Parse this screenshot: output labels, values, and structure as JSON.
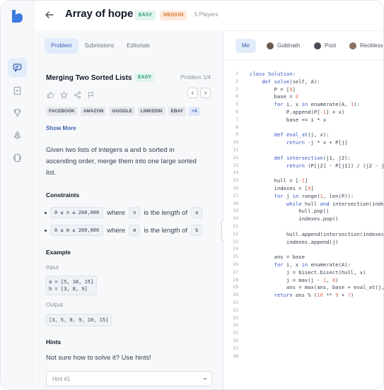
{
  "header": {
    "title": "Array of hope",
    "difficulty_easy": "EASY",
    "difficulty_medium": "MEDIUM",
    "players": "5 Players"
  },
  "sidebar": {
    "items": [
      {
        "icon": "chat-icon",
        "active": true
      },
      {
        "icon": "document-icon",
        "active": false
      },
      {
        "icon": "trophy-icon",
        "active": false
      },
      {
        "icon": "rocket-icon",
        "active": false
      },
      {
        "icon": "layers-icon",
        "active": false
      }
    ]
  },
  "left_tabs": [
    "Problem",
    "Submisions",
    "Editorials"
  ],
  "problem": {
    "title": "Merging Two Sorted Lists",
    "difficulty": "EASY",
    "number": "Problem 1/4",
    "tags": [
      "FACEBOOK",
      "AMAZON",
      "GOOGLE",
      "LINKEDIN",
      "EBAY",
      "+4"
    ],
    "show_more": "Show More",
    "description": "Given two lists of integers a and b sorted in ascending order, merge them into one large sorted list.",
    "constraints_title": "Constraints",
    "constraints": [
      {
        "code": "0 ≤ n ≤ 200,000",
        "where": "where",
        "var": "n",
        "text": "is the length of",
        "target": "a"
      },
      {
        "code": "0 ≤ m ≤ 200,000",
        "where": "where",
        "var": "m",
        "text": "is the length of",
        "target": "b"
      }
    ],
    "example_title": "Example",
    "input_label": "Input",
    "input_value": "a = [5, 10, 15]\nb = [3, 8, 9]",
    "output_label": "Output",
    "output_value": "[3, 5, 8, 9, 10, 15]",
    "hints_title": "Hints",
    "hints_text": "Not sure how to solve it? Use hints!",
    "hint_select": "Hint #1"
  },
  "player_tabs": [
    {
      "label": "Me",
      "active": true
    },
    {
      "label": "Gobinath",
      "active": false
    },
    {
      "label": "Pool",
      "active": false
    },
    {
      "label": "Reckless",
      "active": false
    }
  ],
  "code_lines": [
    {
      "n": "1",
      "html": "<span class='kw'>class</span> <span class='fn'>Solution</span>:"
    },
    {
      "n": "2",
      "html": "    <span class='kw'>def</span> <span class='fn'>solve</span>(self, A):"
    },
    {
      "n": "3",
      "html": "        P = [<span class='num'>0</span>]"
    },
    {
      "n": "4",
      "html": "        base = <span class='num'>0</span>"
    },
    {
      "n": "5",
      "html": "        <span class='kw'>for</span> i, x <span class='kw'>in</span> enumerate(A, <span class='num'>1</span>):"
    },
    {
      "n": "6",
      "html": "            P.append(P[<span class='num'>-1</span>] + x)"
    },
    {
      "n": "7",
      "html": "            base += i * x"
    },
    {
      "n": "8",
      "html": ""
    },
    {
      "n": "9",
      "html": "        <span class='kw'>def</span> <span class='fn'>eval_at</span>(j, x):"
    },
    {
      "n": "10",
      "html": "            <span class='kw'>return</span> -j * x + P[j]"
    },
    {
      "n": "11",
      "html": ""
    },
    {
      "n": "12",
      "html": "        <span class='kw'>def</span> <span class='fn'>intersection</span>(j1, j2):"
    },
    {
      "n": "13",
      "html": "            <span class='kw'>return</span> (P[j2] - P[j1]) / (j2 - j1)"
    },
    {
      "n": "14",
      "html": ""
    },
    {
      "n": "15",
      "html": "        hull = [<span class='num'>-1</span>]"
    },
    {
      "n": "16",
      "html": "        indexes = [<span class='num'>0</span>]"
    },
    {
      "n": "17",
      "html": "        <span class='kw'>for</span> j <span class='kw'>in</span> range(<span class='num'>1</span>, len(P)):"
    },
    {
      "n": "18",
      "html": "            <span class='kw'>while</span> hull <span class='kw'>and</span> intersection(indexes[-1], j) &lt;= hull[-1]:"
    },
    {
      "n": "19",
      "html": "                hull.pop()"
    },
    {
      "n": "20",
      "html": "                indexes.pop()"
    },
    {
      "n": "21",
      "html": ""
    },
    {
      "n": "22",
      "html": "            hull.append(intersection(indexes[-1], j))"
    },
    {
      "n": "23",
      "html": "            indexes.append(j)"
    },
    {
      "n": "24",
      "html": ""
    },
    {
      "n": "25",
      "html": "        ans = base"
    },
    {
      "n": "26",
      "html": "        <span class='kw'>for</span> i, x <span class='kw'>in</span> enumerate(A):"
    },
    {
      "n": "27",
      "html": "            j = bisect.bisect(hull, x)"
    },
    {
      "n": "28",
      "html": "            j = max(j - <span class='num'>1</span>, <span class='num'>0</span>)"
    },
    {
      "n": "29",
      "html": "            ans = max(ans, base + eval_at(j, x))"
    },
    {
      "n": "30",
      "html": "        <span class='kw'>return</span> ans % (<span class='num'>10</span> ** <span class='num'>9</span> + <span class='num'>7</span>)"
    }
  ],
  "code_line_numbers_visible": [
    "1",
    "2",
    "3",
    "4",
    "5",
    "6",
    "7",
    "8",
    "9",
    "10",
    "11",
    "12",
    "13",
    "14",
    "15",
    "16",
    "17",
    "18",
    "19",
    "20",
    "21",
    "22",
    "23",
    "24",
    "25",
    "26",
    "27",
    "28",
    "29",
    "30",
    "31",
    "32",
    "33",
    "34",
    "35",
    "36",
    "37",
    "38"
  ]
}
